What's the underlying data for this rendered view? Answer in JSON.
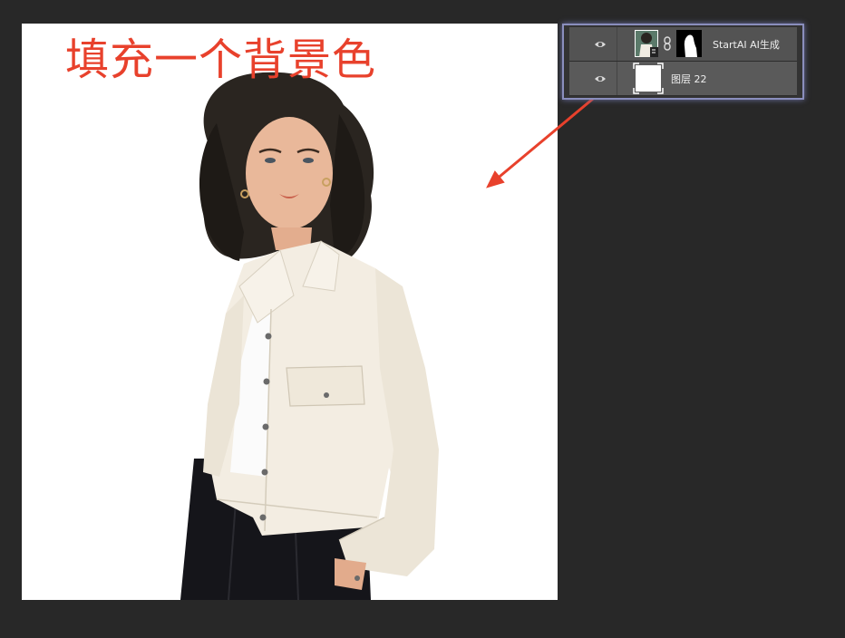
{
  "annotation": {
    "text": "填充一个背景色",
    "color": "#e8412c"
  },
  "canvas": {
    "background": "#ffffff"
  },
  "layers": [
    {
      "name": "StartAI AI生成",
      "visible": true,
      "has_mask": true,
      "thumbnail": "portrait-thumbnail",
      "mask": "silhouette-mask"
    },
    {
      "name": "图层 22",
      "visible": true,
      "has_mask": false,
      "thumbnail": "white-fill-thumbnail"
    }
  ],
  "colors": {
    "app_background": "#282828",
    "panel_highlight": "#8a8ebd",
    "arrow": "#e8412c"
  }
}
